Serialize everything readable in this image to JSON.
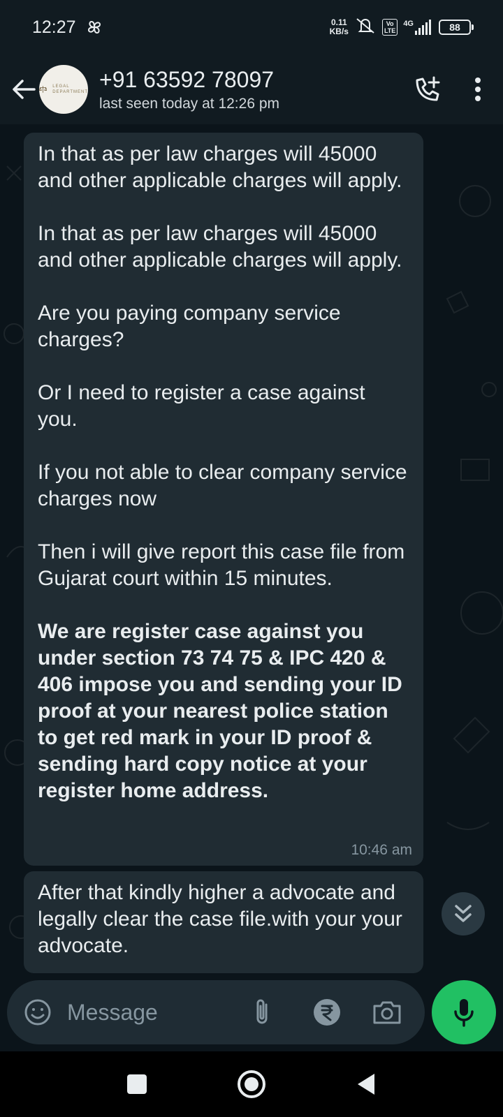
{
  "status_bar": {
    "time": "12:27",
    "net_speed_value": "0.11",
    "net_speed_unit": "KB/s",
    "volte_line1": "Vo",
    "volte_line2": "LTE",
    "network": "4G",
    "battery": "88"
  },
  "header": {
    "avatar_text_line1": "LEGAL",
    "avatar_text_line2": "DEPARTMENT",
    "contact_name": "+91 63592 78097",
    "contact_status": "last seen today at 12:26 pm"
  },
  "messages": [
    {
      "paragraphs": [
        "In that as per law charges will 45000 and other applicable charges will apply.",
        "In that as per law charges will 45000 and other applicable charges will apply.",
        "Are you paying company service charges?",
        "Or I need to register a case against you.",
        "If you not able to clear company service charges now",
        "Then i will give report this case file from Gujarat court within 15 minutes."
      ],
      "bold_paragraph": "We are register case against you under section 73 74 75 & IPC 420 & 406 impose you and sending your ID proof at your nearest police station to get red mark in your ID proof & sending hard copy notice at your register home address.",
      "time": "10:46 am"
    },
    {
      "paragraphs": [
        "After that kindly higher a advocate and legally clear the case file.with your your advocate."
      ]
    }
  ],
  "composer": {
    "placeholder": "Message"
  },
  "colors": {
    "background": "#0b141a",
    "header": "#111b21",
    "bubble_incoming": "#202c33",
    "input_pill": "#1f2c34",
    "accent_green": "#21c063",
    "text_secondary": "#8696a0"
  },
  "icons": {
    "status_left": "pinwheel-icon",
    "back": "arrow-left-icon",
    "call": "add-call-icon",
    "menu": "more-vertical-icon",
    "scroll": "double-chevron-down-icon",
    "emoji": "emoji-icon",
    "attach": "paperclip-icon",
    "pay": "rupee-icon",
    "camera": "camera-icon",
    "mic": "microphone-icon"
  }
}
